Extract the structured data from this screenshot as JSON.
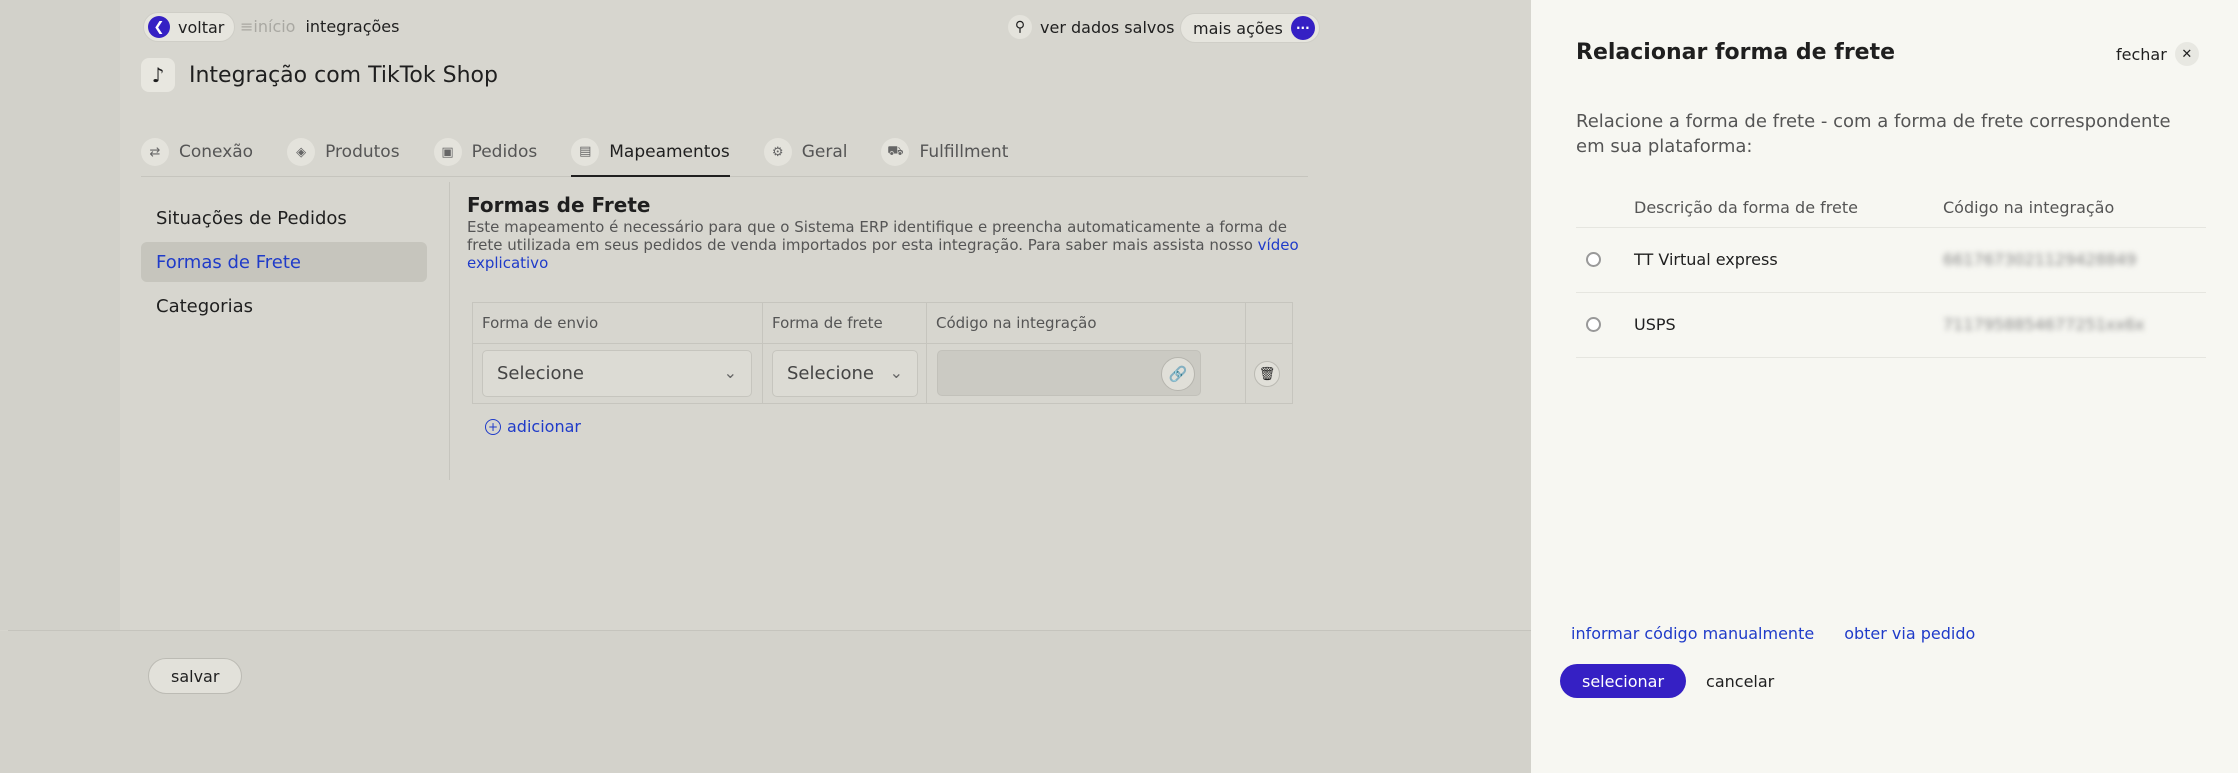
{
  "topbar": {
    "back_label": "voltar",
    "breadcrumb_home": "início",
    "breadcrumb_current": "integrações",
    "saved_data_label": "ver dados salvos",
    "more_actions_label": "mais ações"
  },
  "page": {
    "title": "Integração com TikTok Shop",
    "logo_icon": "tiktok-icon"
  },
  "tabs": [
    {
      "label": "Conexão",
      "icon": "arrows-icon"
    },
    {
      "label": "Produtos",
      "icon": "tag-icon"
    },
    {
      "label": "Pedidos",
      "icon": "cart-icon"
    },
    {
      "label": "Mapeamentos",
      "icon": "hierarchy-icon"
    },
    {
      "label": "Geral",
      "icon": "gear-icon"
    },
    {
      "label": "Fulfillment",
      "icon": "truck-icon"
    }
  ],
  "active_tab": "Mapeamentos",
  "sidenav": [
    {
      "label": "Situações de Pedidos"
    },
    {
      "label": "Formas de Frete"
    },
    {
      "label": "Categorias"
    }
  ],
  "section": {
    "title": "Formas de Frete",
    "description": "Este mapeamento é necessário para que o Sistema ERP identifique e preencha automaticamente a forma de frete utilizada em seus pedidos de venda importados por esta integração. Para saber mais assista nosso ",
    "link_label": "vídeo explicativo"
  },
  "mapping_table": {
    "headers": [
      "Forma de envio",
      "Forma de frete",
      "Código na integração"
    ],
    "row": {
      "shipping_method": "Selecione",
      "freight_method": "Selecione",
      "integration_code": ""
    },
    "add_label": "adicionar"
  },
  "footer": {
    "save_label": "salvar"
  },
  "drawer": {
    "title": "Relacionar forma de frete",
    "close_label": "fechar",
    "description": "Relacione a forma de frete - com a forma de frete correspondente em sua plataforma:",
    "headers": [
      "Descrição da forma de frete",
      "Código na integração"
    ],
    "options": [
      {
        "description": "TT Virtual express",
        "code": "6617673021129428849"
      },
      {
        "description": "USPS",
        "code": "7117958854677251xx6x"
      }
    ],
    "manual_code_label": "informar código manualmente",
    "from_order_label": "obter via pedido",
    "select_label": "selecionar",
    "cancel_label": "cancelar"
  },
  "colors": {
    "accent": "#3520c4",
    "link": "#1f3bc9",
    "overlay_background": "#d6d5ce",
    "drawer_background": "#f7f7f2"
  }
}
